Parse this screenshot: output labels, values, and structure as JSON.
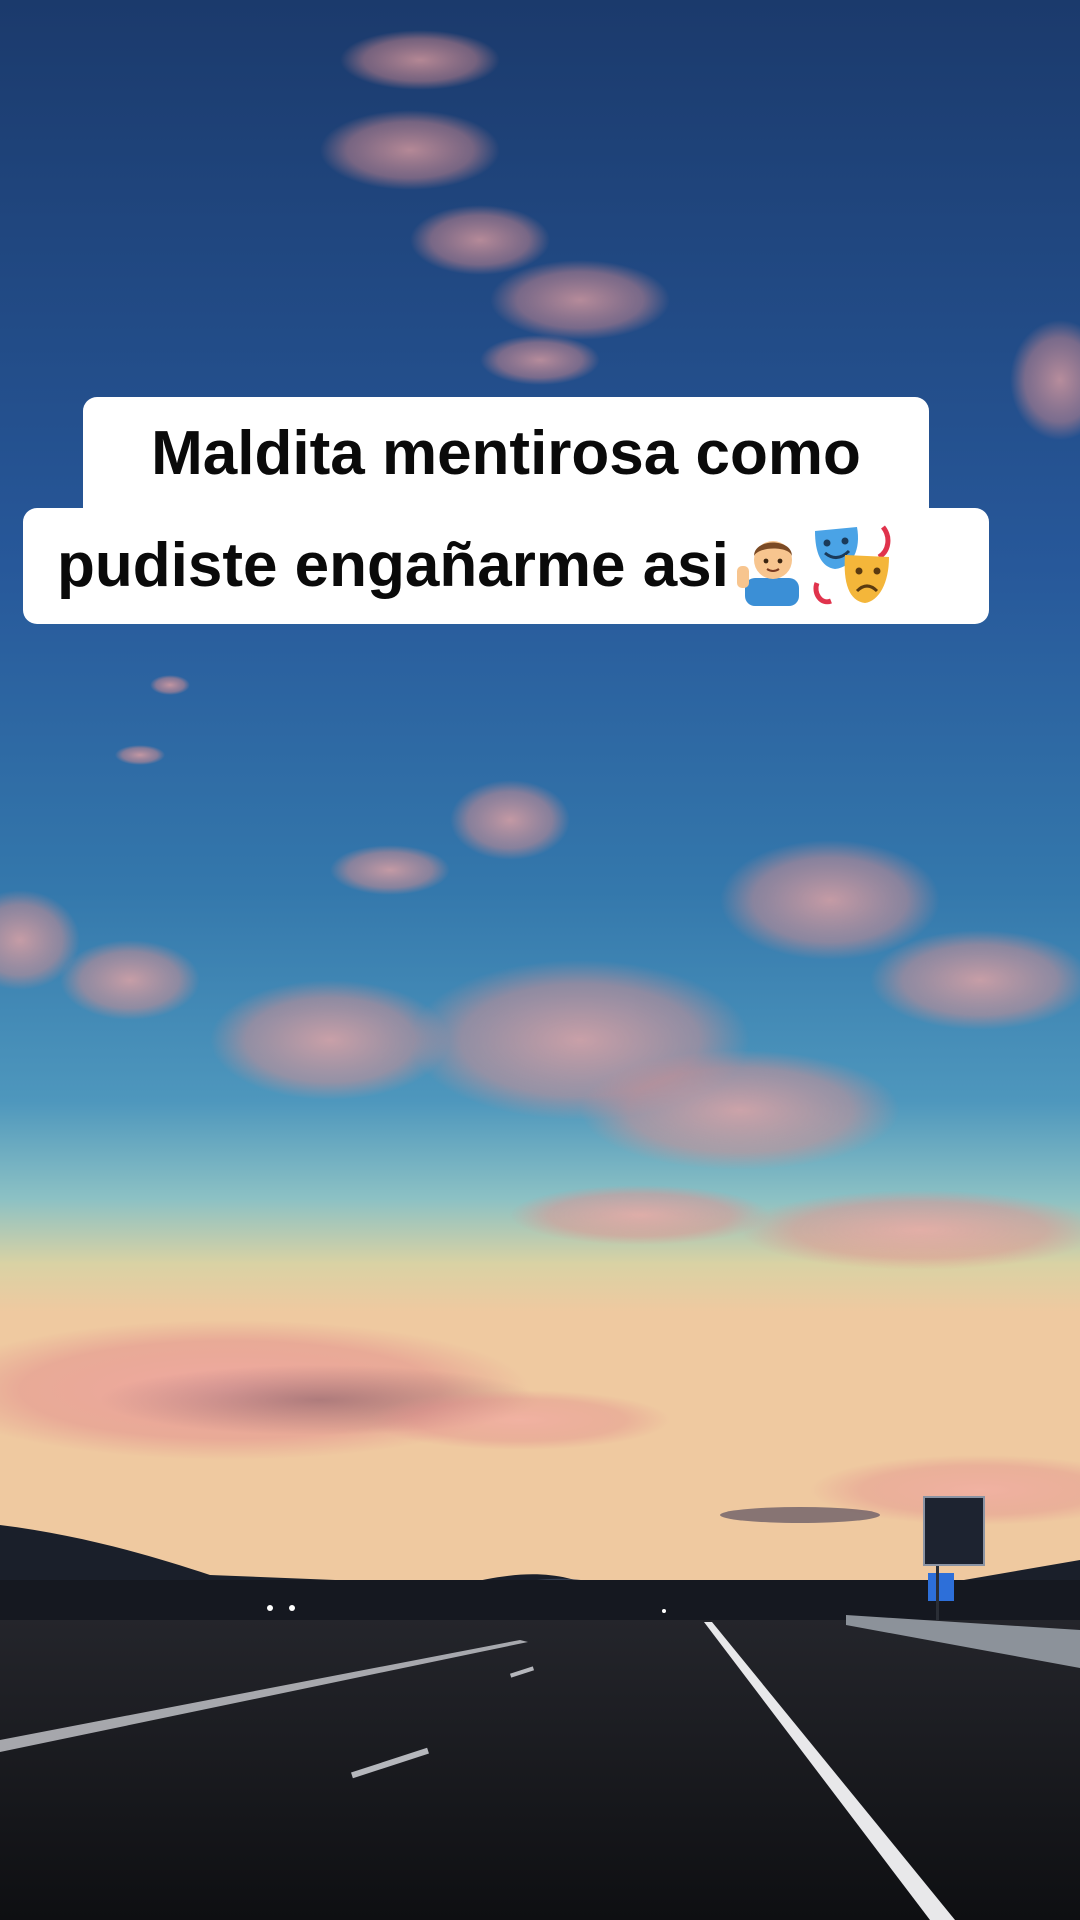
{
  "caption": {
    "line1": "Maldita mentirosa como",
    "line2": "pudiste engañarme asi"
  },
  "emojis": [
    "man-raising-hand-icon",
    "performing-arts-masks-icon"
  ],
  "colors": {
    "sky_top": "#1d3e70",
    "sky_mid": "#3a79a8",
    "sky_horizon": "#e9cf9c",
    "clouds": "#e59a9a",
    "road": "#16171b",
    "caption_bg": "#ffffff",
    "caption_text": "#0a0a0a"
  }
}
